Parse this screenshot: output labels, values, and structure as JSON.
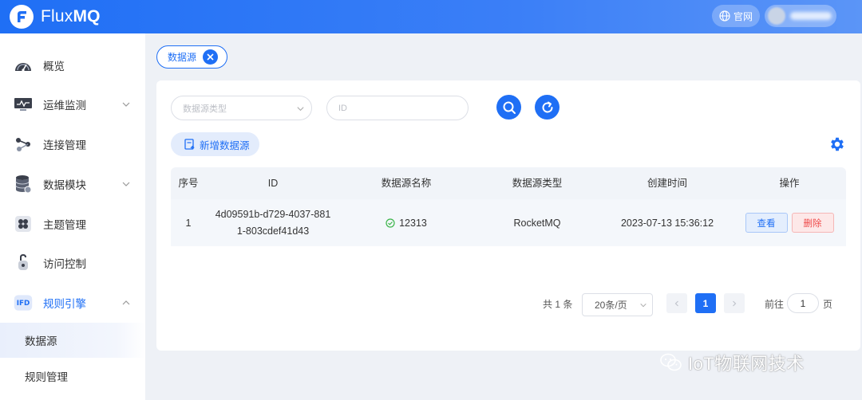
{
  "app": {
    "name_light": "Flux",
    "name_bold": "MQ",
    "site_label": "官网",
    "brand_color": "#1f6ff5"
  },
  "sidebar": {
    "items": [
      {
        "label": "概览",
        "icon": "dashboard-gauge-icon"
      },
      {
        "label": "运维监测",
        "icon": "monitor-icon",
        "expandable": true
      },
      {
        "label": "连接管理",
        "icon": "connections-icon"
      },
      {
        "label": "数据模块",
        "icon": "database-icon",
        "expandable": true
      },
      {
        "label": "主题管理",
        "icon": "topics-icon"
      },
      {
        "label": "访问控制",
        "icon": "access-control-icon"
      },
      {
        "label": "规则引擎",
        "icon": "rule-engine-icon",
        "expandable": true,
        "expanded": true
      }
    ],
    "subitems": [
      {
        "label": "数据源",
        "active": true
      },
      {
        "label": "规则管理",
        "active": false
      }
    ]
  },
  "tab": {
    "label": "数据源"
  },
  "filters": {
    "type_placeholder": "数据源类型",
    "id_placeholder": "ID"
  },
  "toolbar": {
    "add_label": "新增数据源"
  },
  "table": {
    "headers": [
      "序号",
      "ID",
      "数据源名称",
      "数据源类型",
      "创建时间",
      "操作"
    ],
    "rows": [
      {
        "index": "1",
        "id_line1": "4d09591b-d729-4037-881",
        "id_line2": "1-803cdef41d43",
        "name": "12313",
        "type": "RocketMQ",
        "created": "2023-07-13 15:36:12",
        "view_label": "查看",
        "delete_label": "删除"
      }
    ]
  },
  "pagination": {
    "total_text": "共 1 条",
    "page_size": "20条/页",
    "current_page": "1",
    "goto_label": "前往",
    "goto_value": "1",
    "goto_unit": "页"
  },
  "watermark": {
    "text": "IoT物联网技术"
  }
}
